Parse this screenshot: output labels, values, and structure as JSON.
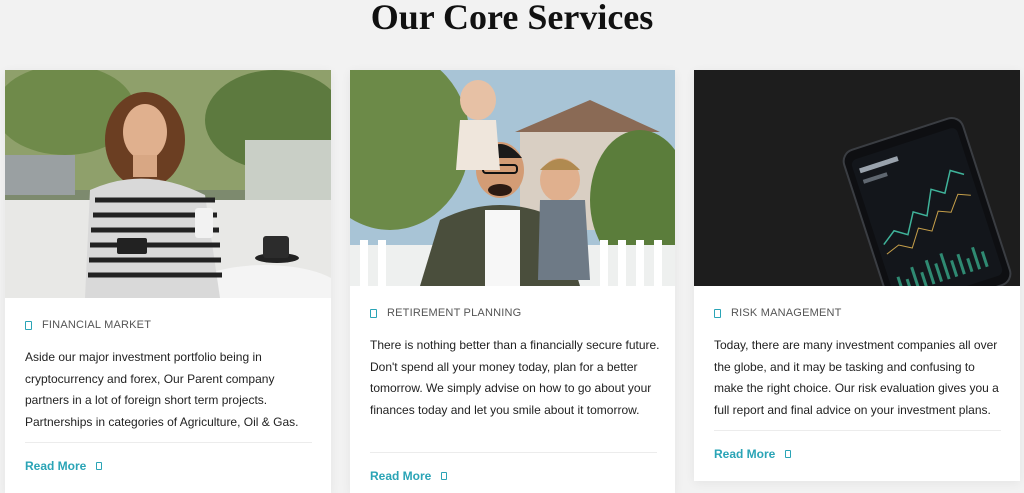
{
  "page": {
    "title": "Our Core Services"
  },
  "colors": {
    "accent": "#2aa4b6",
    "text": "#222222",
    "background": "#f2f2f2"
  },
  "cards": [
    {
      "category": "FINANCIAL MARKET",
      "category_icon": "square-outline-icon",
      "description": "Aside our major investment portfolio being in cryptocurrency and forex, Our Parent company partners in a lot of foreign short term projects. Partnerships in categories of Agriculture, Oil & Gas.",
      "read_more": "Read More"
    },
    {
      "category": "RETIREMENT PLANNING",
      "category_icon": "square-outline-icon",
      "description": "There is nothing better than a financially secure future. Don't spend all your money today, plan for a better tomorrow. We simply advise on how to go about your finances today and let you smile about it tomorrow.",
      "read_more": "Read More"
    },
    {
      "category": "RISK MANAGEMENT",
      "category_icon": "square-outline-icon",
      "description": "Today, there are many investment companies all over the globe, and it may be tasking and confusing to make the right choice. Our risk evaluation gives you a full report and final advice on your investment plans.",
      "read_more": "Read More"
    }
  ]
}
